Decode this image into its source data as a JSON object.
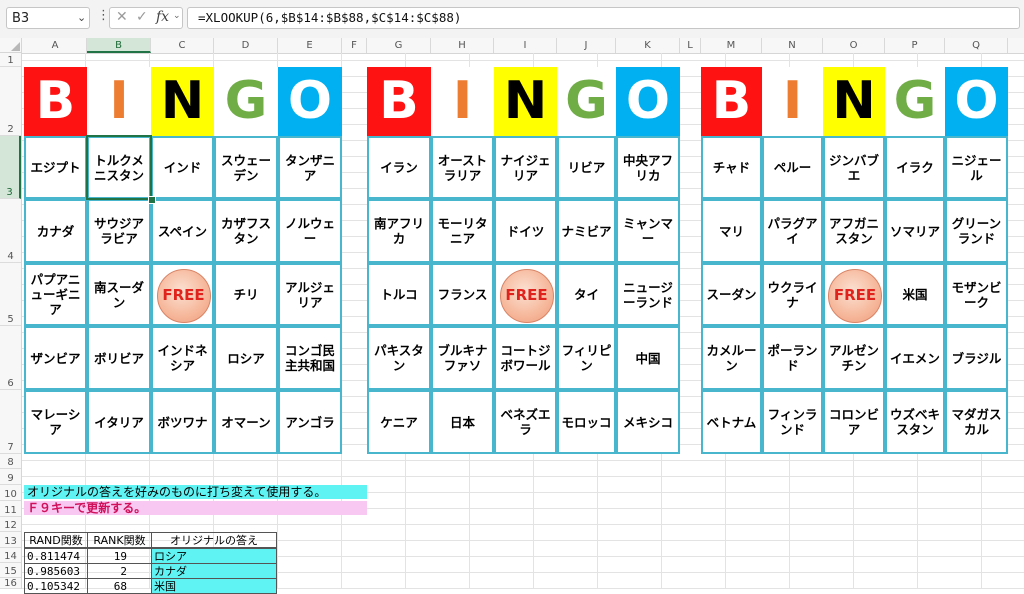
{
  "formula_bar": {
    "name_box": "B3",
    "formula": "=XLOOKUP(6,$B$14:$B$88,$C$14:$C$88)"
  },
  "columns": [
    "A",
    "B",
    "C",
    "D",
    "E",
    "F",
    "G",
    "H",
    "I",
    "J",
    "K",
    "L",
    "M",
    "N",
    "O",
    "P",
    "Q"
  ],
  "rows": [
    "1",
    "2",
    "3",
    "4",
    "5",
    "6",
    "7",
    "8",
    "9",
    "10",
    "11",
    "12",
    "13",
    "14",
    "15",
    "16"
  ],
  "selected_column": "B",
  "selected_row": "3",
  "bingo_header": {
    "letters": [
      "B",
      "I",
      "N",
      "G",
      "O"
    ],
    "bg_colors": [
      "#ff1212",
      "#ffffff",
      "#ffff00",
      "#ffffff",
      "#00b0f0"
    ],
    "fg_colors": [
      "#ffffff",
      "#ed7d31",
      "#000000",
      "#70ad47",
      "#ffffff"
    ]
  },
  "cards": [
    {
      "rows": [
        [
          "エジプト",
          "トルクメニスタン",
          "インド",
          "スウェーデン",
          "タンザニア"
        ],
        [
          "カナダ",
          "サウジアラビア",
          "スペイン",
          "カザフスタン",
          "ノルウェー"
        ],
        [
          "パプアニューギニア",
          "南スーダン",
          "FREE",
          "チリ",
          "アルジェリア"
        ],
        [
          "ザンビア",
          "ボリビア",
          "インドネシア",
          "ロシア",
          "コンゴ民主共和国"
        ],
        [
          "マレーシア",
          "イタリア",
          "ボツワナ",
          "オマーン",
          "アンゴラ"
        ]
      ]
    },
    {
      "rows": [
        [
          "イラン",
          "オーストラリア",
          "ナイジェリア",
          "リビア",
          "中央アフリカ"
        ],
        [
          "南アフリカ",
          "モーリタニア",
          "ドイツ",
          "ナミビア",
          "ミャンマー"
        ],
        [
          "トルコ",
          "フランス",
          "FREE",
          "タイ",
          "ニュージーランド"
        ],
        [
          "パキスタン",
          "ブルキナファソ",
          "コートジボワール",
          "フィリピン",
          "中国"
        ],
        [
          "ケニア",
          "日本",
          "ベネズエラ",
          "モロッコ",
          "メキシコ"
        ]
      ]
    },
    {
      "rows": [
        [
          "チャド",
          "ペルー",
          "ジンバブエ",
          "イラク",
          "ニジェール"
        ],
        [
          "マリ",
          "パラグアイ",
          "アフガニスタン",
          "ソマリア",
          "グリーンランド"
        ],
        [
          "スーダン",
          "ウクライナ",
          "FREE",
          "米国",
          "モザンビーク"
        ],
        [
          "カメルーン",
          "ポーランド",
          "アルゼンチン",
          "イエメン",
          "ブラジル"
        ],
        [
          "ベトナム",
          "フィンランド",
          "コロンビア",
          "ウズベキスタン",
          "マダガスカル"
        ]
      ]
    }
  ],
  "notes": {
    "line1": "オリジナルの答えを好みのものに打ち変えて使用する。",
    "line2": "Ｆ９キーで更新する。"
  },
  "table": {
    "headers": [
      "RAND関数",
      "RANK関数",
      "オリジナルの答え"
    ],
    "rows": [
      [
        "0.811474",
        "19",
        "ロシア"
      ],
      [
        "0.985603",
        "2",
        "カナダ"
      ],
      [
        "0.105342",
        "68",
        "米国"
      ]
    ]
  },
  "colors": {
    "card_border": "#48b6cc",
    "selection": "#217346",
    "note1_bg": "#5ff3f3",
    "note2_bg": "#f9c8f2",
    "note2_text": "#d0105a",
    "free_text": "#e0231d"
  }
}
